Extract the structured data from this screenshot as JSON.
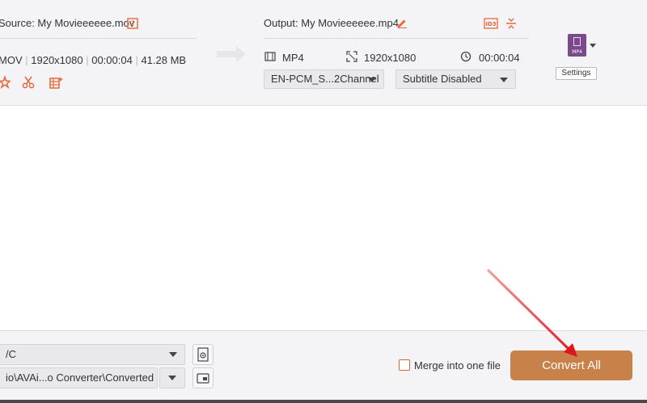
{
  "source": {
    "label": "Source: My Movieeeeee.mov",
    "meta_format": "MOV",
    "meta_resolution": "1920x1080",
    "meta_duration": "00:00:04",
    "meta_size": "41.28 MB"
  },
  "output": {
    "label": "Output: My Movieeeeee.mp4",
    "format": "MP4",
    "resolution": "1920x1080",
    "duration": "00:00:04",
    "audio_track": "EN-PCM_S...2Channel",
    "subtitle": "Subtitle Disabled"
  },
  "profile": {
    "thumb_label": "MP4",
    "settings_label": "Settings"
  },
  "bottom": {
    "output_format_value": "/C",
    "save_path_value": "io\\AVAi...o Converter\\Converted",
    "merge_label": "Merge into one file",
    "merge_checked": false,
    "convert_label": "Convert All"
  },
  "colors": {
    "accent": "#e8663a",
    "convert_button": "#c9814a",
    "annotation_arrow": "#e0141c"
  }
}
